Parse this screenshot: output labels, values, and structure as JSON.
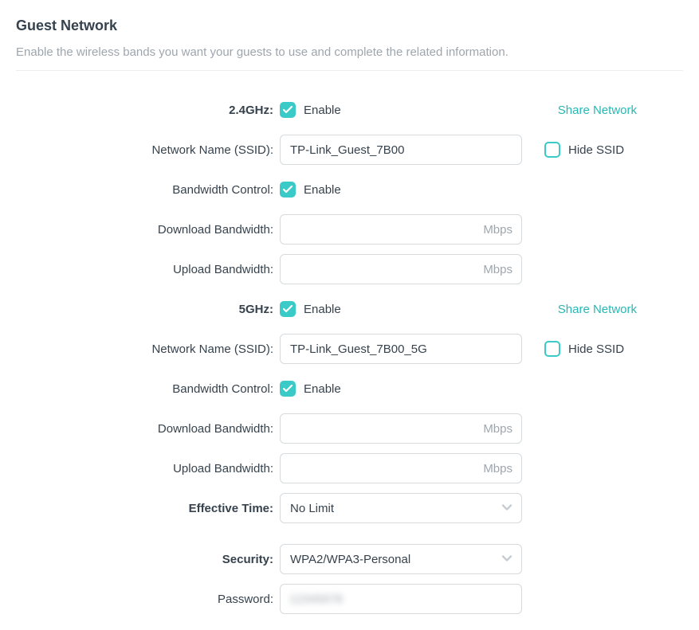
{
  "title": "Guest Network",
  "subtitle": "Enable the wireless bands you want your guests to use and complete the related information.",
  "labels": {
    "band24": "2.4GHz:",
    "band5": "5GHz:",
    "ssid": "Network Name (SSID):",
    "bw": "Bandwidth Control:",
    "dlbw": "Download Bandwidth:",
    "ulbw": "Upload Bandwidth:",
    "eff": "Effective Time:",
    "sec": "Security:",
    "pwd": "Password:",
    "enable": "Enable",
    "hide": "Hide SSID",
    "share": "Share Network",
    "mbps": "Mbps"
  },
  "band24": {
    "enabled": true,
    "ssid": "TP-Link_Guest_7B00",
    "hide_ssid": false,
    "bw_enabled": true,
    "dl_bw": "",
    "ul_bw": ""
  },
  "band5": {
    "enabled": true,
    "ssid": "TP-Link_Guest_7B00_5G",
    "hide_ssid": false,
    "bw_enabled": true,
    "dl_bw": "",
    "ul_bw": ""
  },
  "effective_time": "No Limit",
  "security": "WPA2/WPA3-Personal",
  "password": "12345678"
}
